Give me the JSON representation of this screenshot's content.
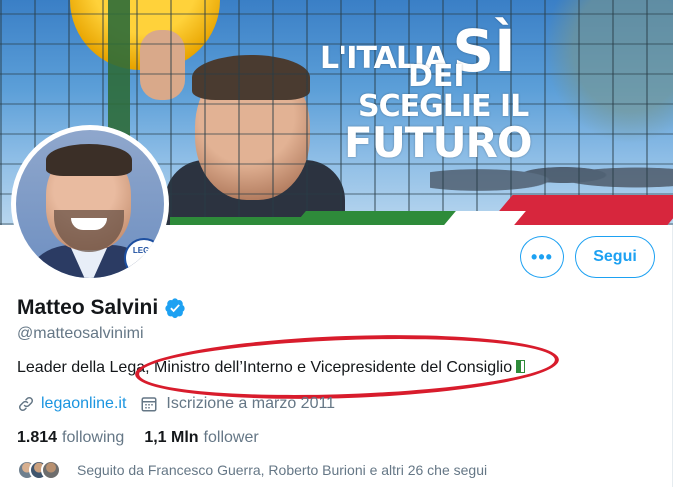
{
  "banner": {
    "slogan_line1": "L'ITALIA",
    "slogan_si": "SÌ",
    "slogan_dei": "DEI",
    "slogan_line2": "SCEGLIE IL",
    "slogan_line3": "FUTURO"
  },
  "avatar": {
    "badge_text": "LEGA"
  },
  "actions": {
    "more_label": "•••",
    "follow_label": "Segui"
  },
  "profile": {
    "name": "Matteo Salvini",
    "handle": "@matteosalvinimi",
    "bio": "Leader della Lega, Ministro dell’Interno e Vicepresidente del Consiglio",
    "website": "legaonline.it",
    "joined": "Iscrizione a marzo 2011"
  },
  "stats": {
    "following_count": "1.814",
    "following_label": "following",
    "followers_count": "1,1 Mln",
    "followers_label": "follower"
  },
  "followed_by": {
    "text": "Seguito da Francesco Guerra, Roberto Burioni e altri 26 che segui"
  },
  "colors": {
    "accent": "#1da1f2",
    "link": "#1b95e0",
    "annotation_circle": "#d81c2c",
    "secondary_text": "#657786"
  },
  "icons": {
    "verified": "verified-badge-icon",
    "link": "link-icon",
    "calendar": "calendar-icon",
    "flag": "italy-flag-emoji"
  }
}
